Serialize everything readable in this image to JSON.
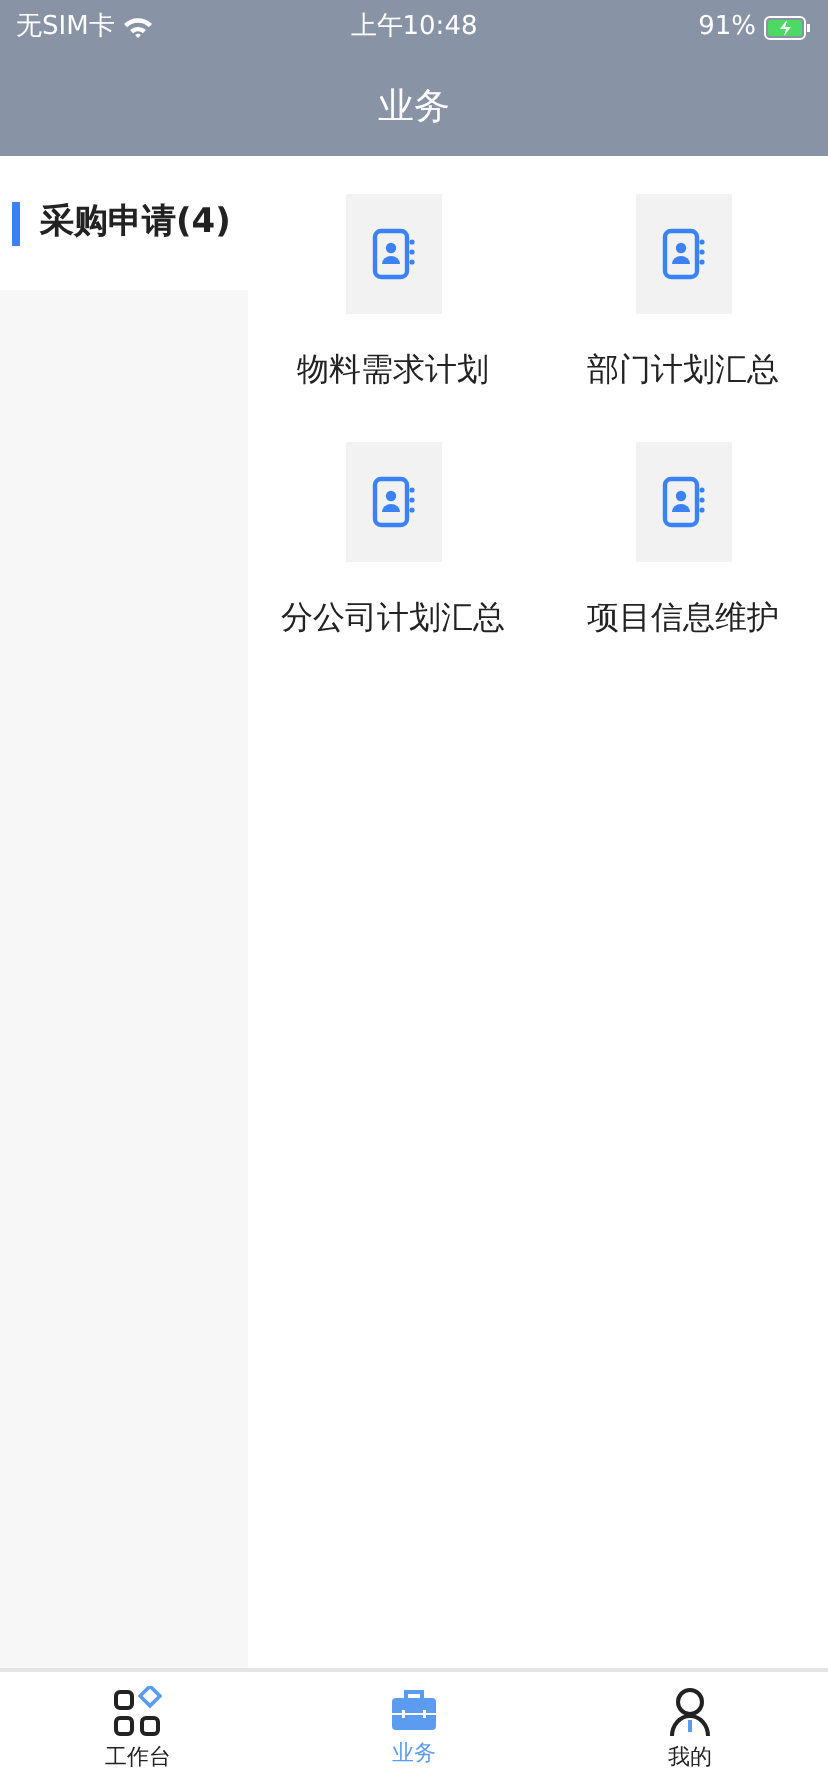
{
  "status_bar": {
    "carrier": "无SIM卡",
    "time": "上午10:48",
    "battery": "91%"
  },
  "header": {
    "title": "业务"
  },
  "sidebar": {
    "items": [
      {
        "label": "采购申请(4)",
        "selected": true
      }
    ]
  },
  "grid": {
    "items": [
      {
        "label": "物料需求计划"
      },
      {
        "label": "部门计划汇总"
      },
      {
        "label": "分公司计划汇总"
      },
      {
        "label": "项目信息维护"
      }
    ]
  },
  "tab_bar": {
    "tabs": [
      {
        "label": "工作台",
        "kind": "workbench",
        "selected": false
      },
      {
        "label": "业务",
        "kind": "business",
        "selected": true
      },
      {
        "label": "我的",
        "kind": "profile",
        "selected": false
      }
    ]
  }
}
